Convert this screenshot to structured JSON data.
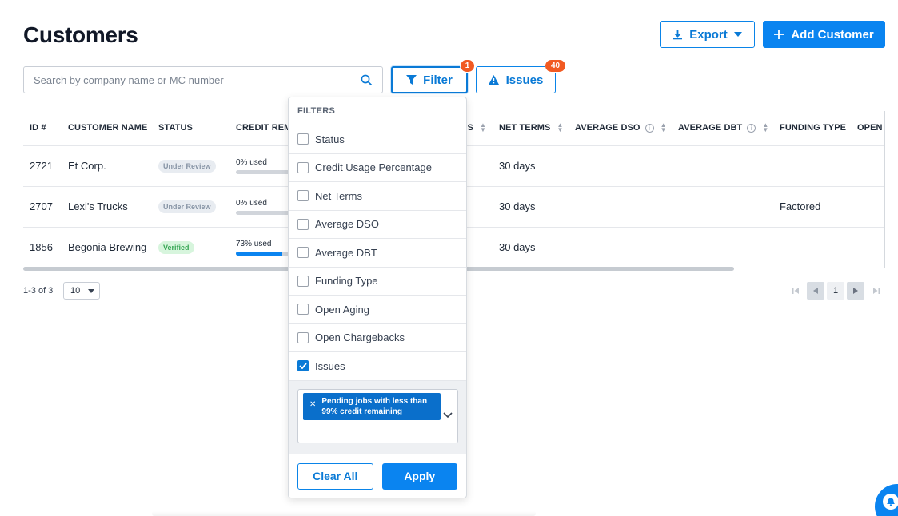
{
  "page": {
    "title": "Customers"
  },
  "header": {
    "export_label": "Export",
    "add_label": "Add Customer"
  },
  "search": {
    "placeholder": "Search by company name or MC number"
  },
  "toolbar": {
    "filter_label": "Filter",
    "filter_count": "1",
    "issues_label": "Issues",
    "issues_count": "40"
  },
  "table": {
    "columns": [
      "ID #",
      "CUSTOMER NAME",
      "STATUS",
      "CREDIT REM",
      "S",
      "NET TERMS",
      "AVERAGE DSO",
      "AVERAGE DBT",
      "FUNDING TYPE",
      "OPEN"
    ],
    "rows": [
      {
        "id": "2721",
        "name": "Et Corp.",
        "status": "Under Review",
        "usage": "0% used",
        "usage_pct": 0,
        "net_terms": "30 days",
        "funding": ""
      },
      {
        "id": "2707",
        "name": "Lexi's Trucks",
        "status": "Under Review",
        "usage": "0% used",
        "usage_pct": 0,
        "net_terms": "30 days",
        "funding": "Factored"
      },
      {
        "id": "1856",
        "name": "Begonia Brewing",
        "status": "Verified",
        "usage": "73% used",
        "usage_pct": 73,
        "net_terms": "30 days",
        "funding": ""
      }
    ]
  },
  "pagination": {
    "count": "1-3 of 3",
    "page_size": "10",
    "current_page": "1"
  },
  "filters": {
    "header": "FILTERS",
    "items": [
      {
        "label": "Status",
        "checked": false
      },
      {
        "label": "Credit Usage Percentage",
        "checked": false
      },
      {
        "label": "Net Terms",
        "checked": false
      },
      {
        "label": "Average DSO",
        "checked": false
      },
      {
        "label": "Average DBT",
        "checked": false
      },
      {
        "label": "Funding Type",
        "checked": false
      },
      {
        "label": "Open Aging",
        "checked": false
      },
      {
        "label": "Open Chargebacks",
        "checked": false
      },
      {
        "label": "Issues",
        "checked": true
      }
    ],
    "selected_tag": "Pending jobs with less than 99% credit remaining",
    "clear_label": "Clear All",
    "apply_label": "Apply"
  },
  "colors": {
    "primary": "#0a84f0",
    "badge": "#f15a22",
    "verified": "#3aa857"
  }
}
